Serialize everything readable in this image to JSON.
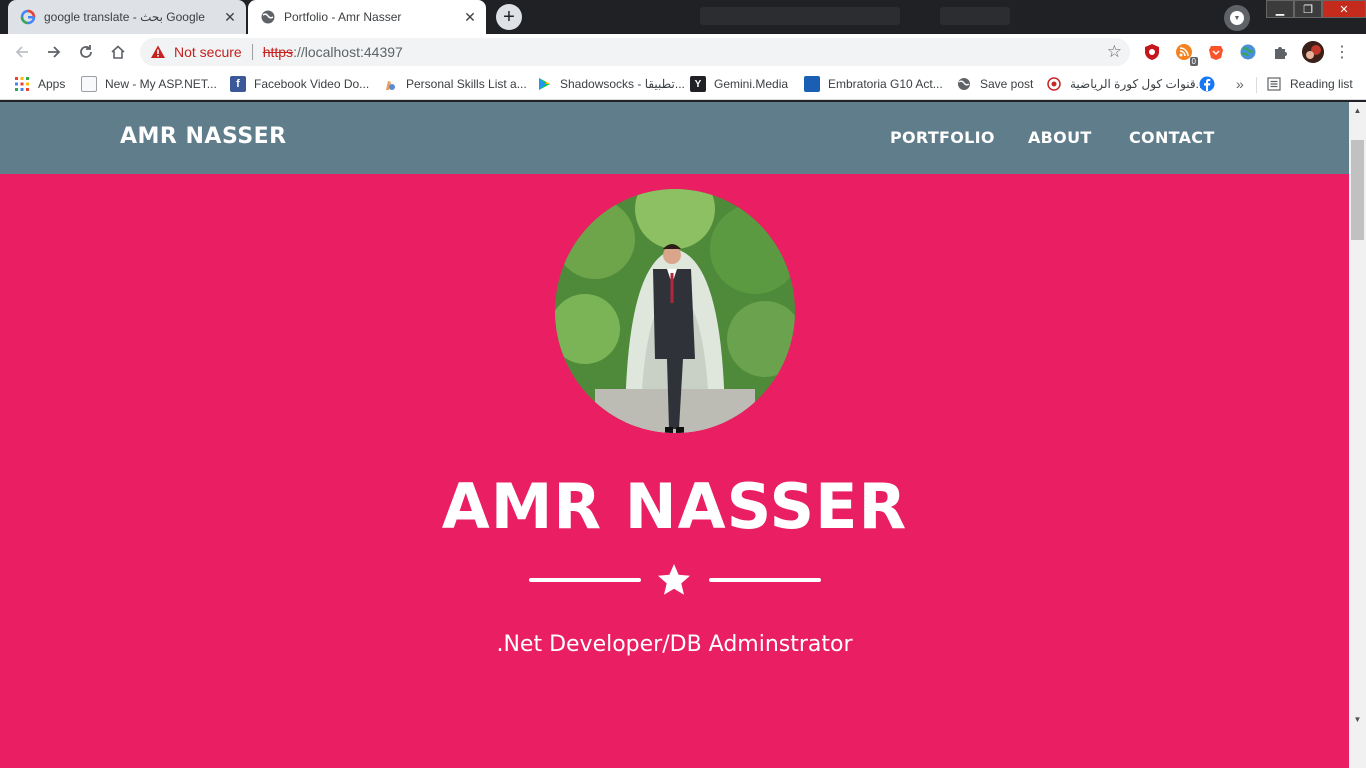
{
  "browser": {
    "tabs": [
      {
        "title": "google translate - بحث Google",
        "favicon": "google-g-icon",
        "active": false
      },
      {
        "title": "Portfolio - Amr Nasser",
        "favicon": "globe-icon",
        "active": true
      }
    ],
    "address": {
      "security_label": "Not secure",
      "scheme": "https",
      "rest": "://localhost:44397"
    },
    "extensions": [
      {
        "name": "ublock-origin-icon",
        "color": "#c4161c"
      },
      {
        "name": "rss-feed-icon",
        "badge": "0",
        "color": "#f5821f"
      },
      {
        "name": "brave-lion-icon",
        "color": "#fb542b"
      },
      {
        "name": "earth-icon",
        "color": "#4a90d9"
      },
      {
        "name": "puzzle-piece-icon",
        "color": "#5f6368"
      }
    ],
    "bookmarks": [
      {
        "label": "Apps",
        "icon": "apps-grid-icon"
      },
      {
        "label": "New - My ASP.NET...",
        "icon": "document-icon"
      },
      {
        "label": "Facebook Video Do...",
        "icon": "facebook-f-icon"
      },
      {
        "label": "Personal Skills List a...",
        "icon": "pen-icon"
      },
      {
        "label": "Shadowsocks - تطبيقا...",
        "icon": "play-store-icon"
      },
      {
        "label": "Gemini.Media",
        "icon": "y-icon"
      },
      {
        "label": "Embratoria G10 Act...",
        "icon": "embratoria-icon"
      },
      {
        "label": "Save post",
        "icon": "globe-icon"
      },
      {
        "label": "قنوات كول كورة الرياضية...",
        "icon": "kora-logo-icon"
      },
      {
        "label": "",
        "icon": "facebook-icon"
      }
    ],
    "overflow_label": "»",
    "reading_list": "Reading list",
    "window_controls": [
      "minimize",
      "maximize",
      "close"
    ]
  },
  "site": {
    "brand": "AMR NASSER",
    "nav": [
      "PORTFOLIO",
      "ABOUT",
      "CONTACT"
    ],
    "masthead": {
      "title": "AMR NASSER",
      "subtitle": ".Net Developer/DB Adminstrator",
      "divider_icon": "star-icon"
    },
    "colors": {
      "navbar": "#607d8b",
      "masthead": "#e91e63",
      "text": "#ffffff"
    }
  }
}
